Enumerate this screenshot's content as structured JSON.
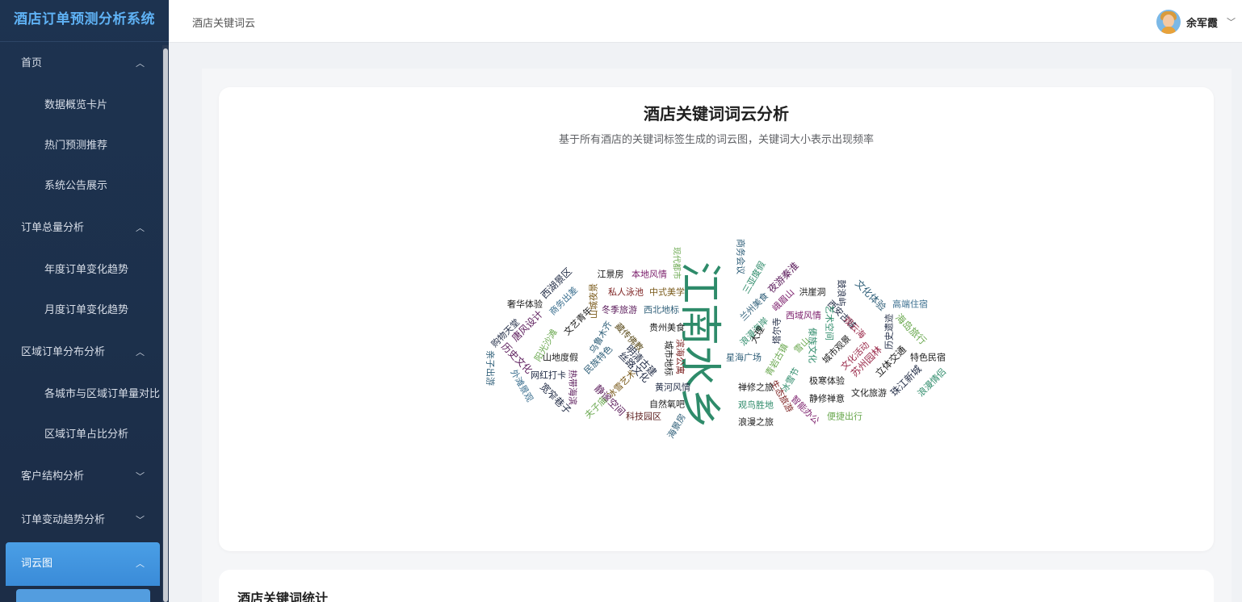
{
  "app": {
    "title": "酒店订单预测分析系统"
  },
  "sidebar": {
    "items": [
      {
        "label": "首页",
        "type": "group",
        "expanded": true
      },
      {
        "label": "数据概览卡片",
        "type": "sub"
      },
      {
        "label": "热门预测推荐",
        "type": "sub"
      },
      {
        "label": "系统公告展示",
        "type": "sub"
      },
      {
        "label": "订单总量分析",
        "type": "group",
        "expanded": true
      },
      {
        "label": "年度订单变化趋势",
        "type": "sub"
      },
      {
        "label": "月度订单变化趋势",
        "type": "sub"
      },
      {
        "label": "区域订单分布分析",
        "type": "group",
        "expanded": true
      },
      {
        "label": "各城市与区域订单量对比",
        "type": "sub"
      },
      {
        "label": "区域订单占比分析",
        "type": "sub"
      },
      {
        "label": "客户结构分析",
        "type": "group",
        "expanded": false
      },
      {
        "label": "订单变动趋势分析",
        "type": "group",
        "expanded": false
      },
      {
        "label": "词云图",
        "type": "group",
        "expanded": true,
        "active": true
      }
    ]
  },
  "header": {
    "breadcrumb": "酒店关键词云",
    "user_name": "余军霞"
  },
  "wordcloud_card": {
    "title": "酒店关键词词云分析",
    "subtitle": "基于所有酒店的关键词标签生成的词云图，关键词大小表示出现频率"
  },
  "stats_card": {
    "title": "酒店关键词统计"
  },
  "colors": {
    "accent": "#3a8bd8",
    "sidebar_bg": "#1c2d47",
    "title_blue": "#5fb2f5",
    "cloud_main": "#2e8b6a"
  },
  "words": [
    {
      "text": "江南水乡",
      "color": "#2e8b6a"
    },
    {
      "text": "西湖景区",
      "color": "#1f2a44"
    },
    {
      "text": "商务出差",
      "color": "#3b6f8f"
    },
    {
      "text": "江景房",
      "color": "#1a1a1a"
    },
    {
      "text": "本地风情",
      "color": "#7a1c6a"
    },
    {
      "text": "现代都市",
      "color": "#6aa84f"
    },
    {
      "text": "商务会议",
      "color": "#2e5e78"
    },
    {
      "text": "三亚度假",
      "color": "#2e8b6a"
    },
    {
      "text": "夜游秦淮",
      "color": "#5a1a5a"
    },
    {
      "text": "洪崖洞",
      "color": "#1a1a1a"
    },
    {
      "text": "鼓浪屿",
      "color": "#1f2a44"
    },
    {
      "text": "文化体验",
      "color": "#2e5e78"
    },
    {
      "text": "奢华体验",
      "color": "#1a1a1a"
    },
    {
      "text": "私人泳池",
      "color": "#7a1c1c"
    },
    {
      "text": "中式美学",
      "color": "#7a5a1a"
    },
    {
      "text": "兰州美食",
      "color": "#2e5e78"
    },
    {
      "text": "峨眉山",
      "color": "#7a1c6a"
    },
    {
      "text": "西安古城",
      "color": "#1f2a44"
    },
    {
      "text": "高端住宿",
      "color": "#3b6f8f"
    },
    {
      "text": "唐风设计",
      "color": "#5a1a5a"
    },
    {
      "text": "文艺青年",
      "color": "#1a1a1a"
    },
    {
      "text": "山城夜景",
      "color": "#7a5a1a"
    },
    {
      "text": "冬季旅游",
      "color": "#5a1a5a"
    },
    {
      "text": "西北地标",
      "color": "#2e5e78"
    },
    {
      "text": "西域风情",
      "color": "#7a1c6a"
    },
    {
      "text": "艺术空间",
      "color": "#2e8b6a"
    },
    {
      "text": "观云海",
      "color": "#9a2a4a"
    },
    {
      "text": "海岛旅行",
      "color": "#6aa84f"
    },
    {
      "text": "购物天堂",
      "color": "#1f2a44"
    },
    {
      "text": "阳光沙滩",
      "color": "#6aa84f"
    },
    {
      "text": "乌鲁木齐",
      "color": "#2e5e78"
    },
    {
      "text": "藏传佛教",
      "color": "#5a4a1a"
    },
    {
      "text": "贵州美食",
      "color": "#1a1a1a"
    },
    {
      "text": "浪漫海岸",
      "color": "#2e8b6a"
    },
    {
      "text": "大理",
      "color": "#1a1a1a"
    },
    {
      "text": "塔尔寺",
      "color": "#1f2a44"
    },
    {
      "text": "雪山",
      "color": "#6aa84f"
    },
    {
      "text": "城市观景",
      "color": "#1a1a1a"
    },
    {
      "text": "文化活动",
      "color": "#9a2a4a"
    },
    {
      "text": "历史遗迹",
      "color": "#1f2a44"
    },
    {
      "text": "历史文化",
      "color": "#5a1a5a"
    },
    {
      "text": "山地度假",
      "color": "#1a1a1a"
    },
    {
      "text": "民族特色",
      "color": "#2e5e78"
    },
    {
      "text": "明清古建",
      "color": "#1f2a44"
    },
    {
      "text": "城市地标",
      "color": "#1a1a1a"
    },
    {
      "text": "滨海公寓",
      "color": "#7a1c1c"
    },
    {
      "text": "星海广场",
      "color": "#2e5e78"
    },
    {
      "text": "青岩古镇",
      "color": "#6aa84f"
    },
    {
      "text": "傣族文化",
      "color": "#2e8b6a"
    },
    {
      "text": "苏州园林",
      "color": "#9a2a4a"
    },
    {
      "text": "立体交通",
      "color": "#1a1a1a"
    },
    {
      "text": "特色民宿",
      "color": "#1a1a1a"
    },
    {
      "text": "亲子出游",
      "color": "#2e5e78"
    },
    {
      "text": "外滩景观",
      "color": "#3b6f8f"
    },
    {
      "text": "网红打卡",
      "color": "#1f2a44"
    },
    {
      "text": "热带海滨",
      "color": "#5a1a5a"
    },
    {
      "text": "冰雪艺术",
      "color": "#7a5a1a"
    },
    {
      "text": "丝路文化",
      "color": "#1f2a44"
    },
    {
      "text": "黄河风情",
      "color": "#1f2a44"
    },
    {
      "text": "生态旅游",
      "color": "#7a1c1c"
    },
    {
      "text": "冰雪节",
      "color": "#2e8b6a"
    },
    {
      "text": "极寒体验",
      "color": "#1a1a1a"
    },
    {
      "text": "珠江新城",
      "color": "#1f2a44"
    },
    {
      "text": "浪漫情侣",
      "color": "#2e8b6a"
    },
    {
      "text": "宽窄巷子",
      "color": "#1f2a44"
    },
    {
      "text": "静谧空间",
      "color": "#5a1a5a"
    },
    {
      "text": "夫子庙",
      "color": "#6aa84f"
    },
    {
      "text": "自然氧吧",
      "color": "#1a1a1a"
    },
    {
      "text": "禅修之旅",
      "color": "#1a1a1a"
    },
    {
      "text": "观鸟胜地",
      "color": "#2e8b6a"
    },
    {
      "text": "智能办公",
      "color": "#7a1c6a"
    },
    {
      "text": "静修禅意",
      "color": "#1a1a1a"
    },
    {
      "text": "文化旅游",
      "color": "#1a1a1a"
    },
    {
      "text": "科技园区",
      "color": "#5a1a1a"
    },
    {
      "text": "海景房",
      "color": "#2e5e78"
    },
    {
      "text": "浪漫之旅",
      "color": "#1a1a1a"
    },
    {
      "text": "便捷出行",
      "color": "#6aa84f"
    }
  ]
}
